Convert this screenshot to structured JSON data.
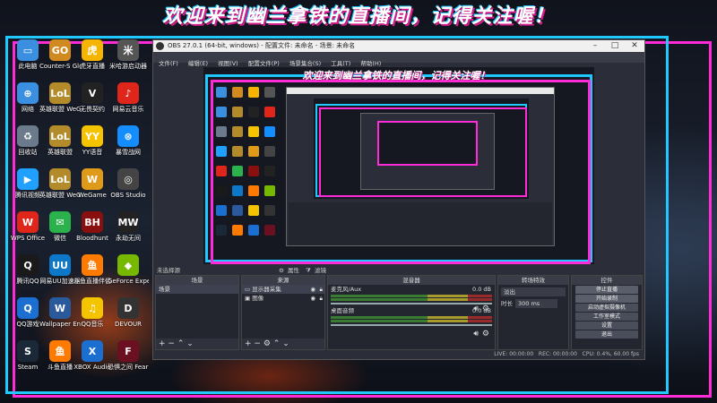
{
  "banner": {
    "text": "欢迎来到幽兰拿铁的直播间，记得关注喔！"
  },
  "desktop_icons": [
    {
      "label": "此电脑",
      "color": "#3b8fe0",
      "glyph": "▭"
    },
    {
      "label": "Counter-S Global Off",
      "color": "#d08a20",
      "glyph": "GO"
    },
    {
      "label": "虎牙直播",
      "color": "#f4b400",
      "glyph": "虎"
    },
    {
      "label": "米哈游启动器",
      "color": "#555",
      "glyph": "米"
    },
    {
      "label": "网络",
      "color": "#3b8fe0",
      "glyph": "⊕"
    },
    {
      "label": "英雄联盟 WeGame版",
      "color": "#b38b2a",
      "glyph": "LoL"
    },
    {
      "label": "无畏契约",
      "color": "#222",
      "glyph": "V"
    },
    {
      "label": "网易云音乐",
      "color": "#e0261b",
      "glyph": "♪"
    },
    {
      "label": "回收站",
      "color": "#6b7b8c",
      "glyph": "♻"
    },
    {
      "label": "英雄联盟",
      "color": "#b38b2a",
      "glyph": "LoL"
    },
    {
      "label": "YY语音",
      "color": "#f5c400",
      "glyph": "YY"
    },
    {
      "label": "暴雪战网",
      "color": "#148eff",
      "glyph": "⊛"
    },
    {
      "label": "腾讯视频",
      "color": "#20a0ff",
      "glyph": "▶"
    },
    {
      "label": "英雄联盟 WeGame版",
      "color": "#b38b2a",
      "glyph": "LoL"
    },
    {
      "label": "WeGame",
      "color": "#e09a1a",
      "glyph": "W"
    },
    {
      "label": "OBS Studio",
      "color": "#444",
      "glyph": "◎"
    },
    {
      "label": "WPS Office",
      "color": "#e0261b",
      "glyph": "W"
    },
    {
      "label": "微信",
      "color": "#2bb24c",
      "glyph": "✉"
    },
    {
      "label": "Bloodhunt",
      "color": "#8a1010",
      "glyph": "BH"
    },
    {
      "label": "永劫无间",
      "color": "#222",
      "glyph": "MW"
    },
    {
      "label": "腾讯QQ",
      "color": "#1a1a1a",
      "glyph": "Q"
    },
    {
      "label": "网易UU加速器",
      "color": "#0e78c8",
      "glyph": "UU"
    },
    {
      "label": "斗鱼直播伴侣",
      "color": "#ff7a00",
      "glyph": "鱼"
    },
    {
      "label": "GeForce Experience",
      "color": "#76b900",
      "glyph": "◆"
    },
    {
      "label": "QQ游戏",
      "color": "#1a6fd0",
      "glyph": "Q"
    },
    {
      "label": "Wallpaper Engine",
      "color": "#2a5a9c",
      "glyph": "W"
    },
    {
      "label": "QQ音乐",
      "color": "#f5c400",
      "glyph": "♫"
    },
    {
      "label": "DEVOUR",
      "color": "#333",
      "glyph": "D"
    },
    {
      "label": "Steam",
      "color": "#1b2838",
      "glyph": "S"
    },
    {
      "label": "斗鱼直播",
      "color": "#ff7a00",
      "glyph": "鱼"
    },
    {
      "label": "XBOX Audio",
      "color": "#1a6fd0",
      "glyph": "X"
    },
    {
      "label": "恐惧之间 Fear sur...",
      "color": "#6a1020",
      "glyph": "F"
    }
  ],
  "obs": {
    "title": "OBS 27.0.1 (64-bit, windows) - 配置文件: 未命名 - 场景: 未命名",
    "menu": [
      "文件(F)",
      "编辑(E)",
      "视图(V)",
      "配置文件(P)",
      "场景集合(S)",
      "工具(T)",
      "帮助(H)"
    ],
    "no_source": "未选择源",
    "properties_label": "属性",
    "filters_label": "滤镜",
    "scenes": {
      "header": "场景",
      "items": [
        "场景"
      ]
    },
    "sources": {
      "header": "来源",
      "items": [
        "显示器采集",
        "图像"
      ]
    },
    "mixer": {
      "header": "混音器",
      "channels": [
        {
          "name": "麦克风/Aux",
          "level": "0.0 dB"
        },
        {
          "name": "桌面音频",
          "level": "0.0 dB"
        }
      ]
    },
    "transitions": {
      "header": "转场特效",
      "type": "淡出",
      "duration_label": "时长",
      "duration": "300 ms"
    },
    "controls": {
      "header": "控件",
      "buttons": [
        "停止直播",
        "开始录制",
        "启动虚拟摄像机",
        "工作室模式",
        "设置",
        "退出"
      ]
    },
    "status": {
      "live": "LIVE: 00:00:00",
      "rec": "REC: 00:00:00",
      "cpu": "CPU: 0.4%, 60.00 fps"
    }
  }
}
